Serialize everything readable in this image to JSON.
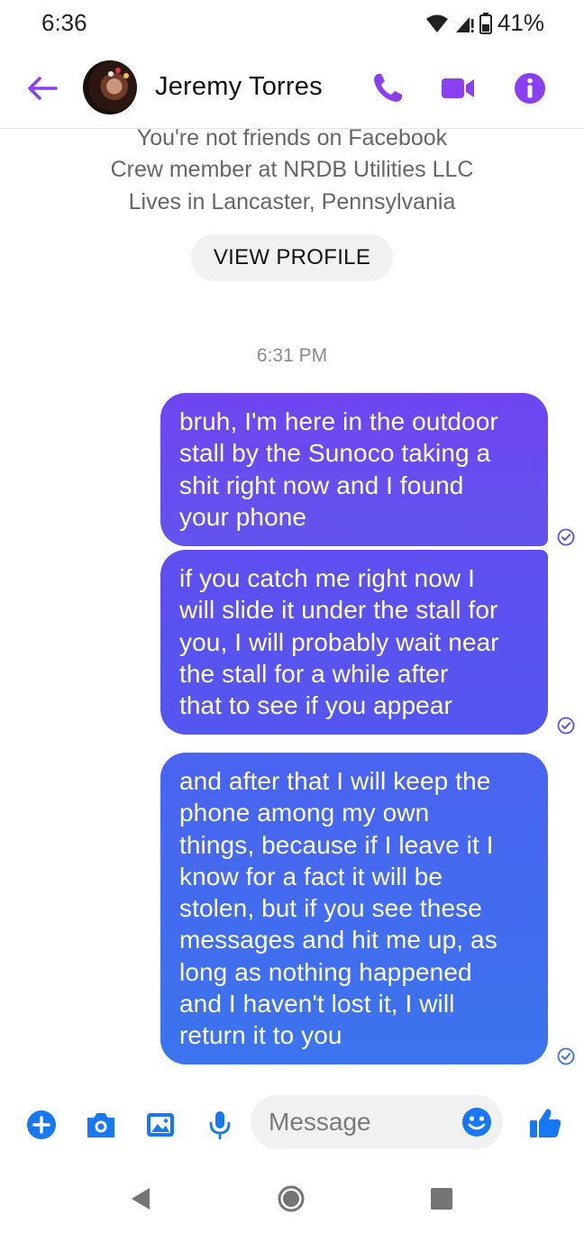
{
  "status_bar": {
    "time": "6:36",
    "battery": "41%"
  },
  "header": {
    "contact_name": "Jeremy Torres",
    "back_icon": "arrow-left-icon",
    "actions": [
      "phone-icon",
      "video-camera-icon",
      "info-icon"
    ],
    "accent_color": "#8a3ff0"
  },
  "profile": {
    "line1": "You're not friends on Facebook",
    "line2": "Crew member at NRDB Utilities LLC",
    "line3": "Lives in Lancaster, Pennsylvania",
    "view_profile_label": "VIEW PROFILE"
  },
  "conversation": {
    "timestamp": "6:31 PM",
    "messages": [
      {
        "lines": [
          "bruh, I'm here in the outdoor",
          "stall by the Sunoco taking a",
          "shit right now and I found",
          "your phone"
        ],
        "status": "sent"
      },
      {
        "lines": [
          "if you catch me right now I",
          "will slide it under the stall for",
          "you, I will probably wait near",
          "the stall for a while after",
          "that to see if you appear"
        ],
        "status": "sent"
      },
      {
        "lines": [
          "and after that I will keep the",
          "phone among my own",
          "things, because if I leave it I",
          "know for a fact it will be",
          "stolen, but if you see these",
          "messages and hit me up, as",
          "long as nothing happened",
          "and I haven't lost it, I will",
          "return it to you"
        ],
        "status": "sent"
      }
    ]
  },
  "composer": {
    "placeholder": "Message",
    "icons": [
      "plus-icon",
      "camera-icon",
      "image-icon",
      "microphone-icon",
      "emoji-icon",
      "thumbs-up-icon"
    ],
    "icon_color": "#1877f2"
  },
  "nav": {
    "icons": [
      "back-triangle-icon",
      "home-circle-icon",
      "recents-square-icon"
    ]
  }
}
